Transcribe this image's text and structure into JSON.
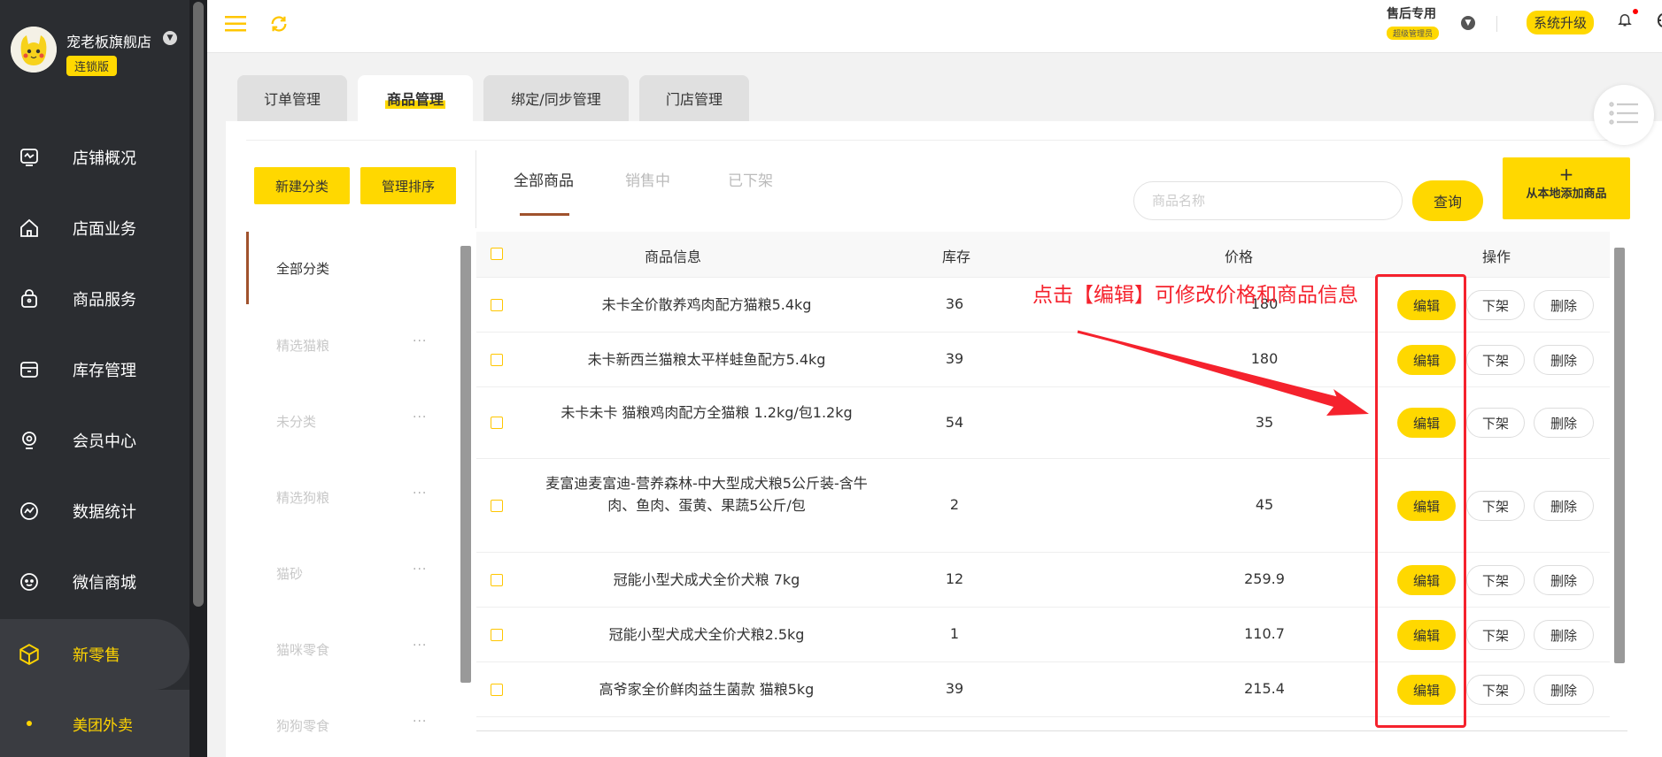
{
  "sidebar": {
    "store_name": "宠老板旗舰店",
    "store_badge": "连锁版",
    "items": [
      {
        "label": "店铺概况",
        "icon": "monitor-icon"
      },
      {
        "label": "店面业务",
        "icon": "home-icon"
      },
      {
        "label": "商品服务",
        "icon": "bag-icon"
      },
      {
        "label": "库存管理",
        "icon": "box-icon"
      },
      {
        "label": "会员中心",
        "icon": "member-icon"
      },
      {
        "label": "数据统计",
        "icon": "chart-icon"
      },
      {
        "label": "微信商城",
        "icon": "wechat-icon"
      },
      {
        "label": "新零售",
        "icon": "cube-icon"
      }
    ],
    "sub_item": "美团外卖"
  },
  "header": {
    "role_title": "售后专用",
    "role_badge": "超级管理员",
    "upgrade_label": "系统升级"
  },
  "top_tabs": [
    "订单管理",
    "商品管理",
    "绑定/同步管理",
    "门店管理"
  ],
  "actions": {
    "new_category": "新建分类",
    "manage_sort": "管理排序",
    "query": "查询",
    "add_local_plus": "+",
    "add_local": "从本地添加商品"
  },
  "sub_tabs": [
    "全部商品",
    "销售中",
    "已下架"
  ],
  "search": {
    "placeholder": "商品名称"
  },
  "categories": {
    "all": "全部分类",
    "items": [
      "精选猫粮",
      "未分类",
      "精选狗粮",
      "猫砂",
      "猫咪零食",
      "狗狗零食"
    ],
    "more": "···"
  },
  "table": {
    "headers": {
      "info": "商品信息",
      "stock": "库存",
      "price": "价格",
      "ops": "操作"
    },
    "edit_label": "编辑",
    "off_label": "下架",
    "delete_label": "删除",
    "rows": [
      {
        "name": "未卡全价散养鸡肉配方猫粮5.4kg",
        "stock": "36",
        "price": "180"
      },
      {
        "name": "未卡新西兰猫粮太平样蛙鱼配方5.4kg",
        "stock": "39",
        "price": "180"
      },
      {
        "name": "未卡未卡 猫粮鸡肉配方全猫粮 1.2kg/包1.2kg",
        "stock": "54",
        "price": "35"
      },
      {
        "name": "麦富迪麦富迪-营养森林-中大型成犬粮5公斤装-含牛肉、鱼肉、蛋黄、果蔬5公斤/包",
        "stock": "2",
        "price": "45"
      },
      {
        "name": "冠能小型犬成犬全价犬粮 7kg",
        "stock": "12",
        "price": "259.9"
      },
      {
        "name": "冠能小型犬成犬全价犬粮2.5kg",
        "stock": "1",
        "price": "110.7"
      },
      {
        "name": "高爷家全价鲜肉益生菌款 猫粮5kg",
        "stock": "39",
        "price": "215.4"
      }
    ]
  },
  "annotation": {
    "text": "点击【编辑】可修改价格和商品信息"
  },
  "colors": {
    "accent": "#ffd800",
    "sidebar": "#2b2d31",
    "annotation": "#f5222d",
    "active_text": "#ffd400"
  }
}
